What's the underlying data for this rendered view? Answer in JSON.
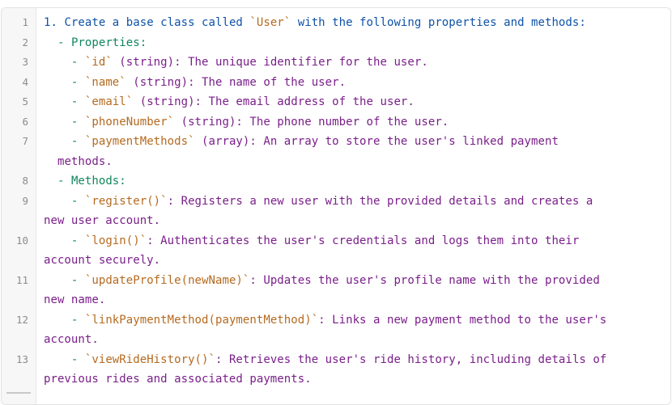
{
  "editor": {
    "lines": [
      {
        "num": "1",
        "indent": "",
        "marker": "1.",
        "segments": [
          {
            "t": "Create a base class called ",
            "c": "list-item"
          },
          {
            "t": "`User`",
            "c": "inline-code"
          },
          {
            "t": " with the following properties and methods:",
            "c": "list-item"
          }
        ]
      },
      {
        "num": "2",
        "indent": "  ",
        "marker": "-",
        "segments": [
          {
            "t": "Properties:",
            "c": "sub-heading"
          }
        ]
      },
      {
        "num": "3",
        "indent": "    ",
        "marker": "-",
        "segments": [
          {
            "t": "`id`",
            "c": "inline-code"
          },
          {
            "t": " (string): The unique identifier for the user.",
            "c": "prose"
          }
        ]
      },
      {
        "num": "4",
        "indent": "    ",
        "marker": "-",
        "segments": [
          {
            "t": "`name`",
            "c": "inline-code"
          },
          {
            "t": " (string): The name of the user.",
            "c": "prose"
          }
        ]
      },
      {
        "num": "5",
        "indent": "    ",
        "marker": "-",
        "segments": [
          {
            "t": "`email`",
            "c": "inline-code"
          },
          {
            "t": " (string): The email address of the user.",
            "c": "prose"
          }
        ]
      },
      {
        "num": "6",
        "indent": "    ",
        "marker": "-",
        "segments": [
          {
            "t": "`phoneNumber`",
            "c": "inline-code"
          },
          {
            "t": " (string): The phone number of the user.",
            "c": "prose"
          }
        ]
      },
      {
        "num": "7",
        "indent": "    ",
        "marker": "-",
        "segments": [
          {
            "t": "`paymentMethods`",
            "c": "inline-code"
          },
          {
            "t": " (array): An array to store the user's linked payment",
            "c": "prose"
          },
          {
            "t": "\n  methods.",
            "c": "prose"
          }
        ]
      },
      {
        "num": "8",
        "indent": "  ",
        "marker": "-",
        "segments": [
          {
            "t": "Methods:",
            "c": "sub-heading"
          }
        ]
      },
      {
        "num": "9",
        "indent": "    ",
        "marker": "-",
        "segments": [
          {
            "t": "`register()`",
            "c": "inline-code"
          },
          {
            "t": ": Registers a new user with the provided details and creates a",
            "c": "prose"
          },
          {
            "t": "\nnew user account.",
            "c": "prose"
          }
        ]
      },
      {
        "num": "10",
        "indent": "    ",
        "marker": "-",
        "segments": [
          {
            "t": "`login()`",
            "c": "inline-code"
          },
          {
            "t": ": Authenticates the user's credentials and logs them into their",
            "c": "prose"
          },
          {
            "t": "\naccount securely.",
            "c": "prose"
          }
        ]
      },
      {
        "num": "11",
        "indent": "    ",
        "marker": "-",
        "segments": [
          {
            "t": "`updateProfile(newName)`",
            "c": "inline-code"
          },
          {
            "t": ": Updates the user's profile name with the provided",
            "c": "prose"
          },
          {
            "t": "\nnew name.",
            "c": "prose"
          }
        ]
      },
      {
        "num": "12",
        "indent": "    ",
        "marker": "-",
        "segments": [
          {
            "t": "`linkPaymentMethod(paymentMethod)`",
            "c": "inline-code"
          },
          {
            "t": ": Links a new payment method to the user's",
            "c": "prose"
          },
          {
            "t": "\naccount.",
            "c": "prose"
          }
        ]
      },
      {
        "num": "13",
        "indent": "    ",
        "marker": "-",
        "segments": [
          {
            "t": "`viewRideHistory()`",
            "c": "inline-code"
          },
          {
            "t": ": Retrieves the user's ride history, including details of",
            "c": "prose"
          },
          {
            "t": "\nprevious rides and associated payments.",
            "c": "prose"
          }
        ]
      }
    ]
  }
}
